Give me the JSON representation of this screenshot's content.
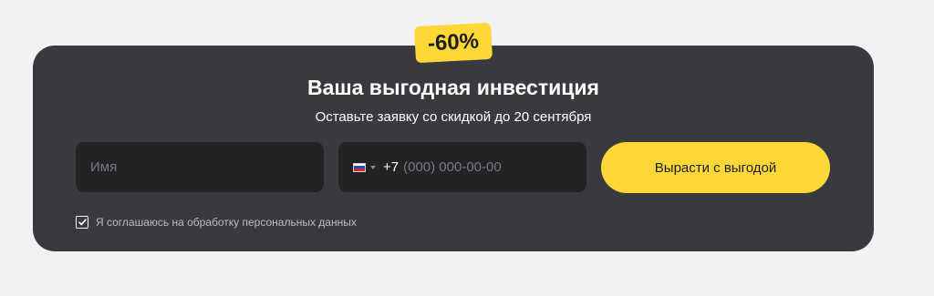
{
  "promo": {
    "badge": "-60%",
    "title": "Ваша выгодная инвестиция",
    "subtitle": "Оставьте заявку со скидкой до 20 сентября"
  },
  "form": {
    "name_placeholder": "Имя",
    "phone_prefix": "+7",
    "phone_placeholder": "(000) 000-00-00",
    "country_flag": "russia-flag-icon",
    "submit_label": "Вырасти с выгодой",
    "consent_label": "Я соглашаюсь на обработку персональных данных",
    "consent_checked": true
  },
  "colors": {
    "accent": "#ffd737",
    "card_bg": "#3a393e",
    "field_bg": "#232326",
    "page_bg": "#f2f2f4"
  }
}
